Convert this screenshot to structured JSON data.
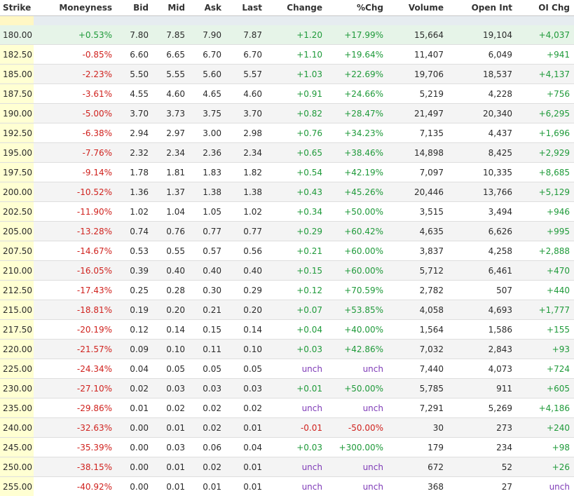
{
  "columns": {
    "strike": "Strike",
    "moneyness": "Moneyness",
    "bid": "Bid",
    "mid": "Mid",
    "ask": "Ask",
    "last": "Last",
    "change": "Change",
    "pct_chg": "%Chg",
    "volume": "Volume",
    "open_int": "Open Int",
    "oi_chg": "OI Chg"
  },
  "rows": [
    {
      "strike": "180.00",
      "moneyness": "+0.53%",
      "bid": "7.80",
      "mid": "7.85",
      "ask": "7.90",
      "last": "7.87",
      "change": "+1.20",
      "pct_chg": "+17.99%",
      "volume": "15,664",
      "open_int": "19,104",
      "oi_chg": "+4,037"
    },
    {
      "strike": "182.50",
      "moneyness": "-0.85%",
      "bid": "6.60",
      "mid": "6.65",
      "ask": "6.70",
      "last": "6.70",
      "change": "+1.10",
      "pct_chg": "+19.64%",
      "volume": "11,407",
      "open_int": "6,049",
      "oi_chg": "+941"
    },
    {
      "strike": "185.00",
      "moneyness": "-2.23%",
      "bid": "5.50",
      "mid": "5.55",
      "ask": "5.60",
      "last": "5.57",
      "change": "+1.03",
      "pct_chg": "+22.69%",
      "volume": "19,706",
      "open_int": "18,537",
      "oi_chg": "+4,137"
    },
    {
      "strike": "187.50",
      "moneyness": "-3.61%",
      "bid": "4.55",
      "mid": "4.60",
      "ask": "4.65",
      "last": "4.60",
      "change": "+0.91",
      "pct_chg": "+24.66%",
      "volume": "5,219",
      "open_int": "4,228",
      "oi_chg": "+756"
    },
    {
      "strike": "190.00",
      "moneyness": "-5.00%",
      "bid": "3.70",
      "mid": "3.73",
      "ask": "3.75",
      "last": "3.70",
      "change": "+0.82",
      "pct_chg": "+28.47%",
      "volume": "21,497",
      "open_int": "20,340",
      "oi_chg": "+6,295"
    },
    {
      "strike": "192.50",
      "moneyness": "-6.38%",
      "bid": "2.94",
      "mid": "2.97",
      "ask": "3.00",
      "last": "2.98",
      "change": "+0.76",
      "pct_chg": "+34.23%",
      "volume": "7,135",
      "open_int": "4,437",
      "oi_chg": "+1,696"
    },
    {
      "strike": "195.00",
      "moneyness": "-7.76%",
      "bid": "2.32",
      "mid": "2.34",
      "ask": "2.36",
      "last": "2.34",
      "change": "+0.65",
      "pct_chg": "+38.46%",
      "volume": "14,898",
      "open_int": "8,425",
      "oi_chg": "+2,929"
    },
    {
      "strike": "197.50",
      "moneyness": "-9.14%",
      "bid": "1.78",
      "mid": "1.81",
      "ask": "1.83",
      "last": "1.82",
      "change": "+0.54",
      "pct_chg": "+42.19%",
      "volume": "7,097",
      "open_int": "10,335",
      "oi_chg": "+8,685"
    },
    {
      "strike": "200.00",
      "moneyness": "-10.52%",
      "bid": "1.36",
      "mid": "1.37",
      "ask": "1.38",
      "last": "1.38",
      "change": "+0.43",
      "pct_chg": "+45.26%",
      "volume": "20,446",
      "open_int": "13,766",
      "oi_chg": "+5,129"
    },
    {
      "strike": "202.50",
      "moneyness": "-11.90%",
      "bid": "1.02",
      "mid": "1.04",
      "ask": "1.05",
      "last": "1.02",
      "change": "+0.34",
      "pct_chg": "+50.00%",
      "volume": "3,515",
      "open_int": "3,494",
      "oi_chg": "+946"
    },
    {
      "strike": "205.00",
      "moneyness": "-13.28%",
      "bid": "0.74",
      "mid": "0.76",
      "ask": "0.77",
      "last": "0.77",
      "change": "+0.29",
      "pct_chg": "+60.42%",
      "volume": "4,635",
      "open_int": "6,626",
      "oi_chg": "+995"
    },
    {
      "strike": "207.50",
      "moneyness": "-14.67%",
      "bid": "0.53",
      "mid": "0.55",
      "ask": "0.57",
      "last": "0.56",
      "change": "+0.21",
      "pct_chg": "+60.00%",
      "volume": "3,837",
      "open_int": "4,258",
      "oi_chg": "+2,888"
    },
    {
      "strike": "210.00",
      "moneyness": "-16.05%",
      "bid": "0.39",
      "mid": "0.40",
      "ask": "0.40",
      "last": "0.40",
      "change": "+0.15",
      "pct_chg": "+60.00%",
      "volume": "5,712",
      "open_int": "6,461",
      "oi_chg": "+470"
    },
    {
      "strike": "212.50",
      "moneyness": "-17.43%",
      "bid": "0.25",
      "mid": "0.28",
      "ask": "0.30",
      "last": "0.29",
      "change": "+0.12",
      "pct_chg": "+70.59%",
      "volume": "2,782",
      "open_int": "507",
      "oi_chg": "+440"
    },
    {
      "strike": "215.00",
      "moneyness": "-18.81%",
      "bid": "0.19",
      "mid": "0.20",
      "ask": "0.21",
      "last": "0.20",
      "change": "+0.07",
      "pct_chg": "+53.85%",
      "volume": "4,058",
      "open_int": "4,693",
      "oi_chg": "+1,777"
    },
    {
      "strike": "217.50",
      "moneyness": "-20.19%",
      "bid": "0.12",
      "mid": "0.14",
      "ask": "0.15",
      "last": "0.14",
      "change": "+0.04",
      "pct_chg": "+40.00%",
      "volume": "1,564",
      "open_int": "1,586",
      "oi_chg": "+155"
    },
    {
      "strike": "220.00",
      "moneyness": "-21.57%",
      "bid": "0.09",
      "mid": "0.10",
      "ask": "0.11",
      "last": "0.10",
      "change": "+0.03",
      "pct_chg": "+42.86%",
      "volume": "7,032",
      "open_int": "2,843",
      "oi_chg": "+93"
    },
    {
      "strike": "225.00",
      "moneyness": "-24.34%",
      "bid": "0.04",
      "mid": "0.05",
      "ask": "0.05",
      "last": "0.05",
      "change": "unch",
      "pct_chg": "unch",
      "volume": "7,440",
      "open_int": "4,073",
      "oi_chg": "+724"
    },
    {
      "strike": "230.00",
      "moneyness": "-27.10%",
      "bid": "0.02",
      "mid": "0.03",
      "ask": "0.03",
      "last": "0.03",
      "change": "+0.01",
      "pct_chg": "+50.00%",
      "volume": "5,785",
      "open_int": "911",
      "oi_chg": "+605"
    },
    {
      "strike": "235.00",
      "moneyness": "-29.86%",
      "bid": "0.01",
      "mid": "0.02",
      "ask": "0.02",
      "last": "0.02",
      "change": "unch",
      "pct_chg": "unch",
      "volume": "7,291",
      "open_int": "5,269",
      "oi_chg": "+4,186"
    },
    {
      "strike": "240.00",
      "moneyness": "-32.63%",
      "bid": "0.00",
      "mid": "0.01",
      "ask": "0.02",
      "last": "0.01",
      "change": "-0.01",
      "pct_chg": "-50.00%",
      "volume": "30",
      "open_int": "273",
      "oi_chg": "+240"
    },
    {
      "strike": "245.00",
      "moneyness": "-35.39%",
      "bid": "0.00",
      "mid": "0.03",
      "ask": "0.06",
      "last": "0.04",
      "change": "+0.03",
      "pct_chg": "+300.00%",
      "volume": "179",
      "open_int": "234",
      "oi_chg": "+98"
    },
    {
      "strike": "250.00",
      "moneyness": "-38.15%",
      "bid": "0.00",
      "mid": "0.01",
      "ask": "0.02",
      "last": "0.01",
      "change": "unch",
      "pct_chg": "unch",
      "volume": "672",
      "open_int": "52",
      "oi_chg": "+26"
    },
    {
      "strike": "255.00",
      "moneyness": "-40.92%",
      "bid": "0.00",
      "mid": "0.01",
      "ask": "0.01",
      "last": "0.01",
      "change": "unch",
      "pct_chg": "unch",
      "volume": "368",
      "open_int": "27",
      "oi_chg": "unch"
    }
  ],
  "colors": {
    "positive": "#1f9a3a",
    "negative": "#d0221e",
    "unchanged": "#7e3ab7",
    "strike_bg": "#ffffd2",
    "atm_row_bg": "#e6f4e8",
    "alt_row_bg": "#f4f4f4"
  }
}
